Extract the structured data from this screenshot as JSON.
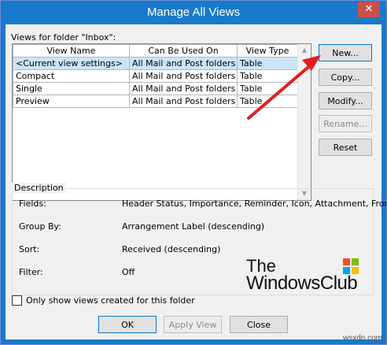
{
  "window": {
    "title": "Manage All Views",
    "close_glyph": "✕"
  },
  "views": {
    "label": "Views for folder \"Inbox\":",
    "columns": [
      "View Name",
      "Can Be Used On",
      "View Type"
    ],
    "rows": [
      {
        "name": "<Current view settings>",
        "used_on": "All Mail and Post folders",
        "type": "Table"
      },
      {
        "name": "Compact",
        "used_on": "All Mail and Post folders",
        "type": "Table"
      },
      {
        "name": "Single",
        "used_on": "All Mail and Post folders",
        "type": "Table"
      },
      {
        "name": "Preview",
        "used_on": "All Mail and Post folders",
        "type": "Table"
      }
    ],
    "selected_index": 0
  },
  "buttons": {
    "new": "New...",
    "copy": "Copy...",
    "modify": "Modify...",
    "rename": "Rename...",
    "reset": "Reset",
    "ok": "OK",
    "apply": "Apply View",
    "close": "Close"
  },
  "description": {
    "title": "Description",
    "fields_label": "Fields:",
    "fields_value": "Header Status, Importance, Reminder, Icon, Attachment, From",
    "group_label": "Group By:",
    "group_value": "Arrangement Label (descending)",
    "sort_label": "Sort:",
    "sort_value": "Received (descending)",
    "filter_label": "Filter:",
    "filter_value": "Off"
  },
  "checkbox": {
    "label": "Only show views created for this folder",
    "checked": false
  },
  "watermark": {
    "line1": "The",
    "line2": "WindowsClub",
    "site": "wsxdn.com"
  },
  "colors": {
    "titlebar": "#1979ca",
    "annotation_arrow": "#e02020",
    "selection": "#cce4f7"
  }
}
